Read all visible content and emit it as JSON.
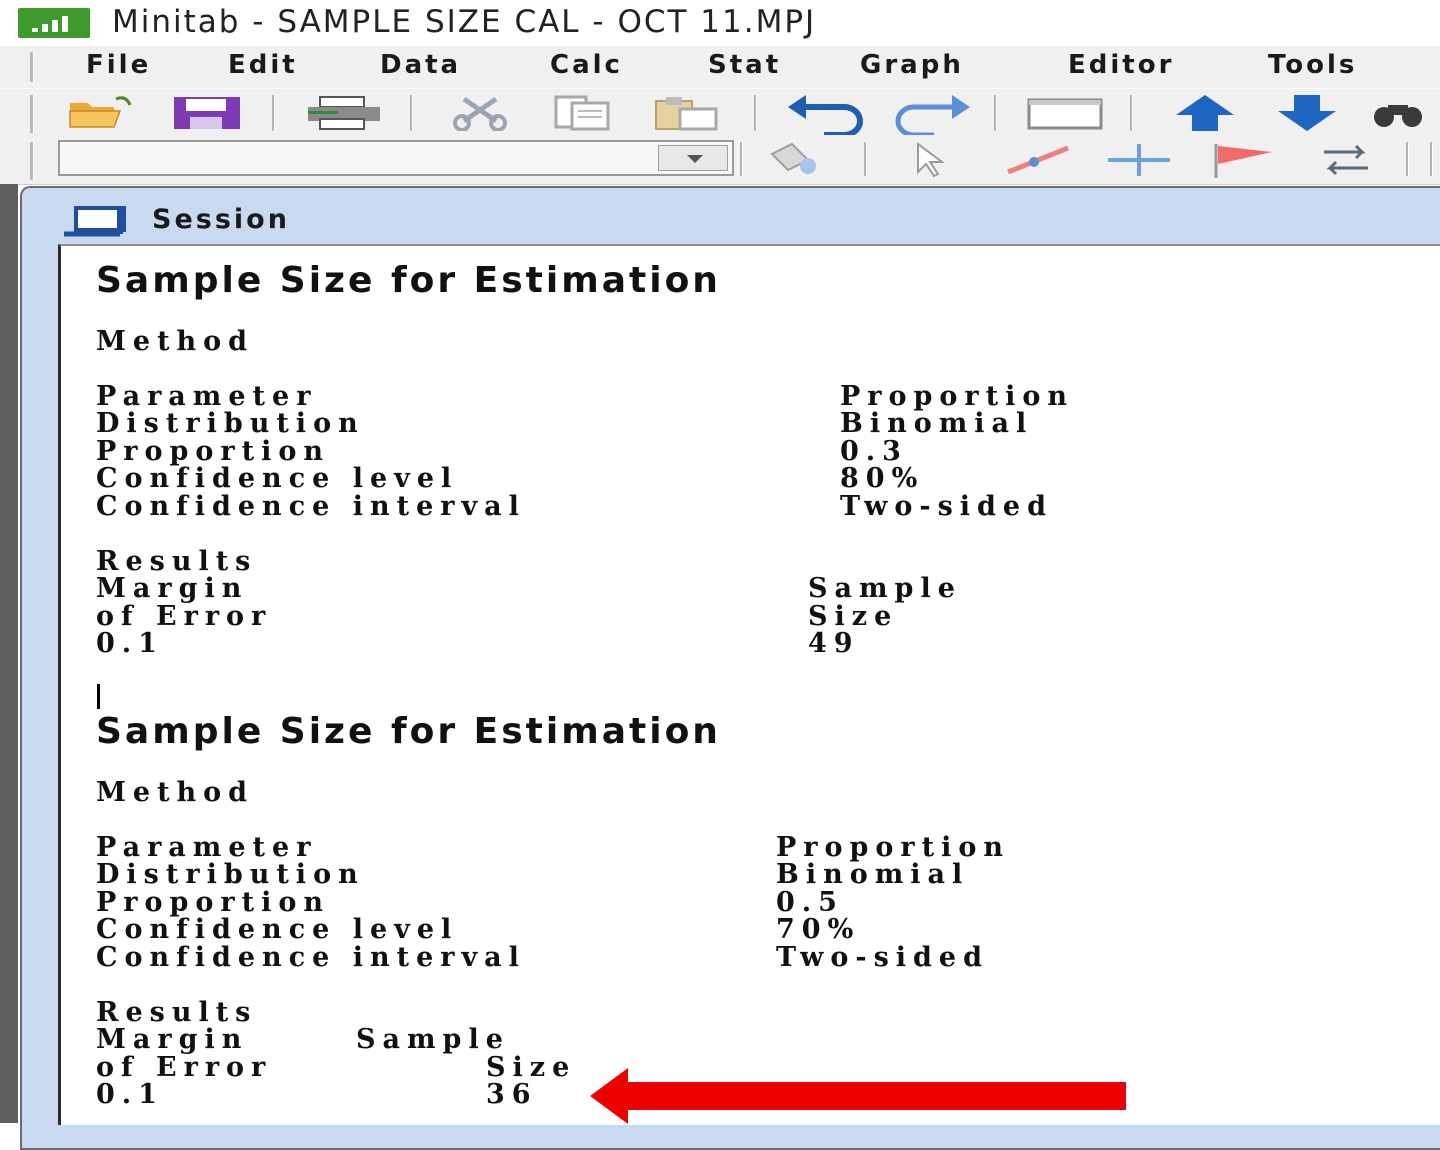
{
  "window": {
    "title": "Minitab - SAMPLE SIZE CAL - OCT 11.MPJ"
  },
  "menu": {
    "items": [
      "File",
      "Edit",
      "Data",
      "Calc",
      "Stat",
      "Graph",
      "Editor",
      "Tools"
    ]
  },
  "toolbar": {
    "icons": [
      "open-folder-icon",
      "save-icon",
      "print-icon",
      "cut-icon",
      "copy-icon",
      "paste-icon",
      "undo-icon",
      "redo-icon",
      "window-icon",
      "previous-icon",
      "next-icon",
      "find-icon"
    ],
    "command_combo_value": ""
  },
  "session": {
    "title": "Session",
    "blocks": [
      {
        "heading": "Sample Size for Estimation",
        "method_label": "Method",
        "rows": [
          {
            "label": "Parameter",
            "value": "Proportion"
          },
          {
            "label": "Distribution",
            "value": "Binomial"
          },
          {
            "label": "Proportion",
            "value": "0.3"
          },
          {
            "label": "Confidence level",
            "value": "80%"
          },
          {
            "label": "Confidence interval",
            "value": "Two-sided"
          }
        ],
        "results_label": "Results",
        "col1_line1": "Margin",
        "col1_line2": "of Error",
        "col2_line1": "Sample",
        "col2_line2": "Size",
        "margin": "0.1",
        "size": "49"
      },
      {
        "heading": "Sample Size for Estimation",
        "method_label": "Method",
        "rows": [
          {
            "label": "Parameter",
            "value": "Proportion"
          },
          {
            "label": "Distribution",
            "value": "Binomial"
          },
          {
            "label": "Proportion",
            "value": "0.5"
          },
          {
            "label": "Confidence level",
            "value": "70%"
          },
          {
            "label": "Confidence interval",
            "value": "Two-sided"
          }
        ],
        "results_label": "Results",
        "col1_line1": "Margin",
        "col1_line2": "of Error",
        "col2_line1": "Sample",
        "col2_line2": "Size",
        "margin": "0.1",
        "size": "36"
      }
    ]
  },
  "annotation": {
    "arrow_color": "#ee0000"
  }
}
